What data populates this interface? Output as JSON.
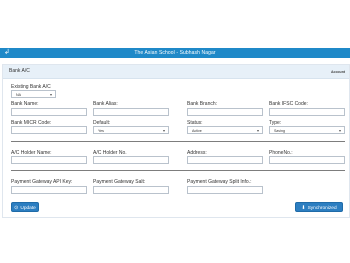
{
  "header": {
    "title": "The Asian School - Subhash Nagar",
    "back_icon": "back-arrow-icon"
  },
  "panel": {
    "title": "Bank A/C",
    "right_label": "Account"
  },
  "existing_bank": {
    "label": "Existing Bank A/C",
    "value": "NA"
  },
  "fields": {
    "bank_name": {
      "label": "Bank Name:",
      "value": ""
    },
    "bank_alias": {
      "label": "Bank Alias:",
      "value": ""
    },
    "bank_branch": {
      "label": "Bank Branch:",
      "value": ""
    },
    "bank_ifsc": {
      "label": "Bank IFSC Code:",
      "value": ""
    },
    "bank_micr": {
      "label": "Bank MICR Code:",
      "value": ""
    },
    "default": {
      "label": "Default:",
      "value": "Yes"
    },
    "status": {
      "label": "Status:",
      "value": "Active"
    },
    "type": {
      "label": "Type:",
      "value": "Saving"
    },
    "holder_name": {
      "label": "A/C Holder Name:",
      "value": ""
    },
    "holder_no": {
      "label": "A/C Holder No.",
      "value": ""
    },
    "address": {
      "label": "Address:",
      "value": ""
    },
    "phone": {
      "label": "PhoneNo.:",
      "value": ""
    },
    "pg_api_key": {
      "label": "Payment Gateway API Key:",
      "value": ""
    },
    "pg_salt": {
      "label": "Payment Gateway Salt:",
      "value": ""
    },
    "pg_split": {
      "label": "Payment Gateway Split Info.:",
      "value": ""
    }
  },
  "buttons": {
    "update": "Update",
    "synchronized": "Synchronized"
  },
  "colors": {
    "accent": "#1f89c8",
    "button": "#2c7ec1",
    "panel_head": "#e7f0f8"
  }
}
